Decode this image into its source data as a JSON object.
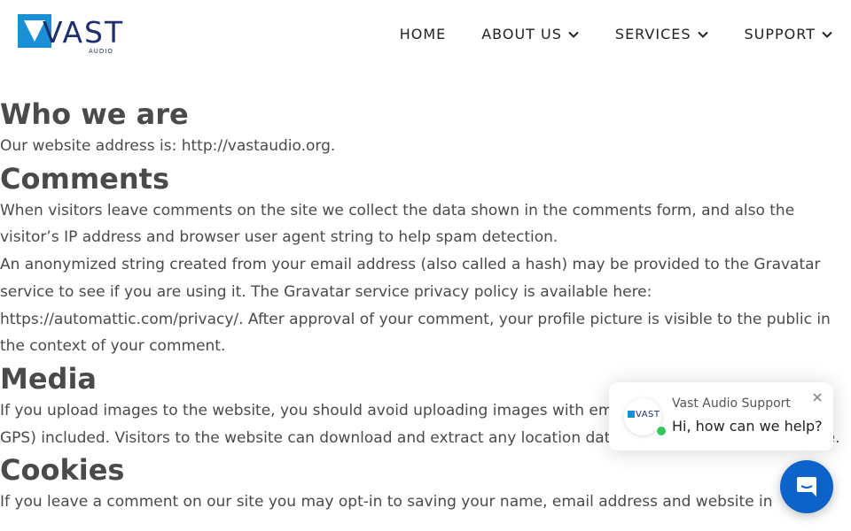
{
  "brand": {
    "logo_text": "VAST",
    "logo_subtext": "AUDIO",
    "colors": {
      "accent": "#1a8fd6",
      "navy": "#1f2f6b",
      "chat_button": "#0d63c8",
      "online": "#35c759"
    }
  },
  "nav": {
    "items": [
      {
        "label": "HOME",
        "has_dropdown": false
      },
      {
        "label": "ABOUT US",
        "has_dropdown": true
      },
      {
        "label": "SERVICES",
        "has_dropdown": true
      },
      {
        "label": "SUPPORT",
        "has_dropdown": true
      }
    ]
  },
  "sections": [
    {
      "heading": "Who we are",
      "paragraphs": [
        "Our website address is: http://vastaudio.org."
      ]
    },
    {
      "heading": "Comments",
      "paragraphs": [
        "When visitors leave comments on the site we collect the data shown in the comments form, and also the visitor’s IP address and browser user agent string to help spam detection.",
        "An anonymized string created from your email address (also called a hash) may be provided to the Gravatar service to see if you are using it. The Gravatar service privacy policy is available here: https://automattic.com/privacy/. After approval of your comment, your profile picture is visible to the public in the context of your comment."
      ]
    },
    {
      "heading": "Media",
      "paragraphs": [
        "If you upload images to the website, you should avoid uploading images with embedded location data (EXIF GPS) included. Visitors to the website can download and extract any location data from images on the website."
      ]
    },
    {
      "heading": "Cookies",
      "paragraphs": [
        "If you leave a comment on our site you may opt-in to saving your name, email address and website in"
      ]
    }
  ],
  "chat": {
    "agent_name": "Vast Audio Support",
    "message": "Hi, how can we help?",
    "avatar_text": "VAST",
    "icons": {
      "close": "close-icon",
      "launcher": "chat-bubble-icon"
    }
  }
}
